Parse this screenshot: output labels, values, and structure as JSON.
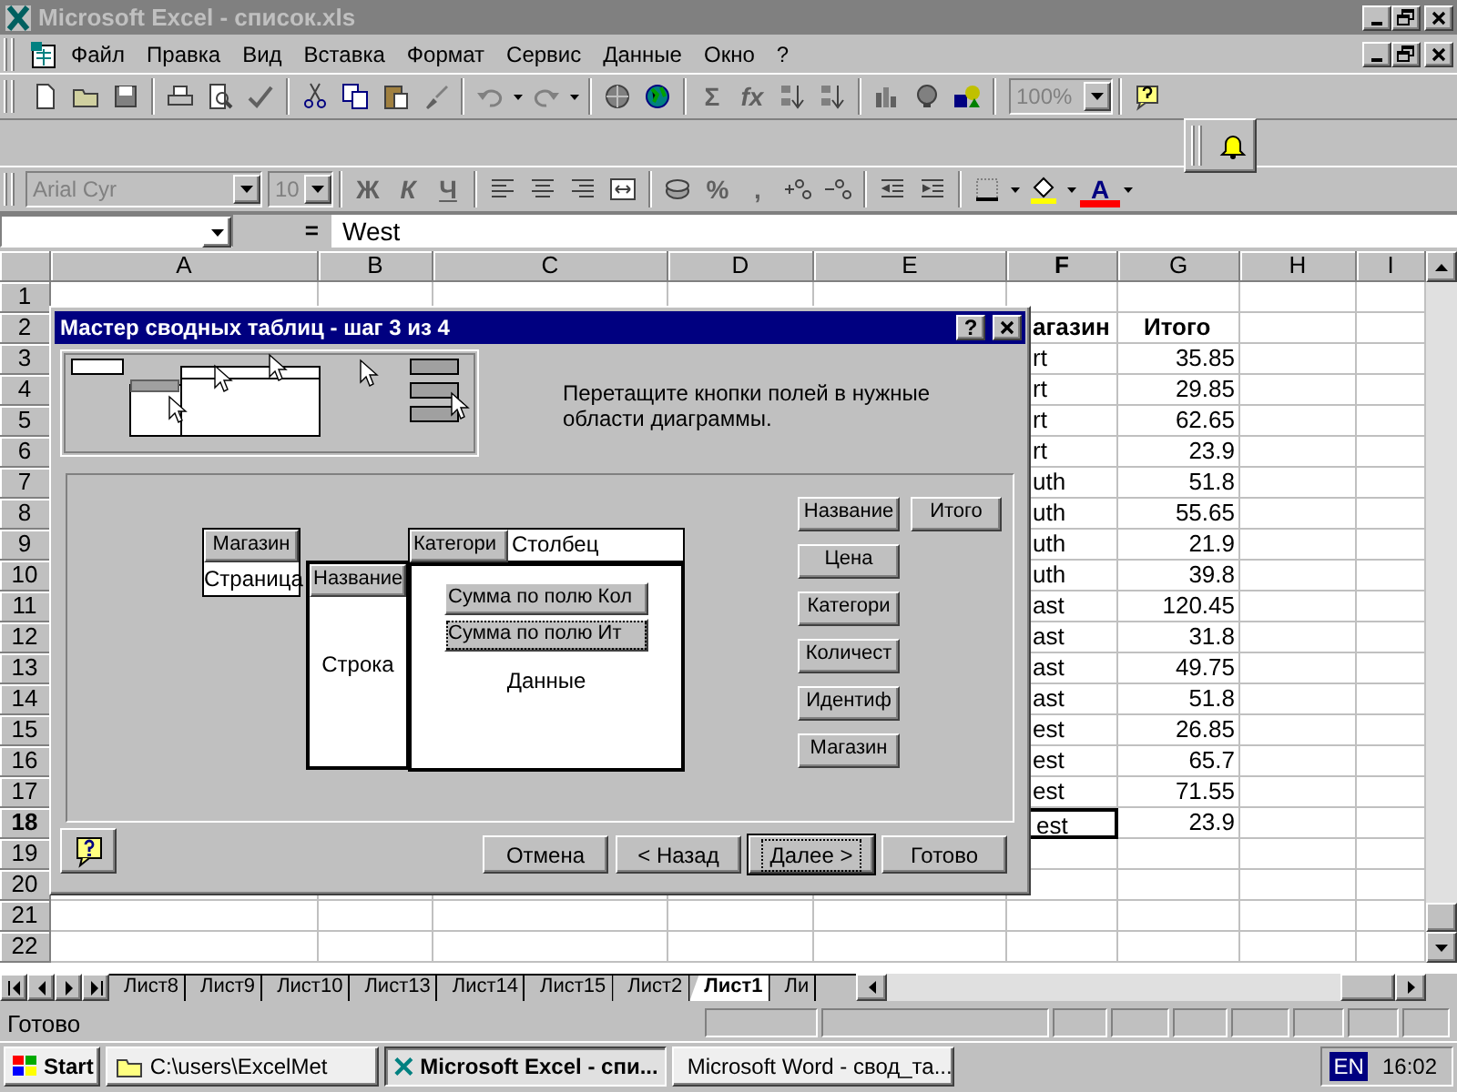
{
  "window": {
    "title": "Microsoft Excel - список.xls"
  },
  "menu": [
    {
      "label": "Файл"
    },
    {
      "label": "Правка"
    },
    {
      "label": "Вид"
    },
    {
      "label": "Вставка"
    },
    {
      "label": "Формат"
    },
    {
      "label": "Сервис"
    },
    {
      "label": "Данные"
    },
    {
      "label": "Окно"
    },
    {
      "label": "?"
    }
  ],
  "standard_toolbar": {
    "autosum": "Σ",
    "function": "fx",
    "zoom": "100%"
  },
  "formatting_toolbar": {
    "font": "Arial Cyr",
    "size": "10",
    "styles": [
      "Ж",
      "К",
      "Ч"
    ],
    "number_formats": [
      "%",
      ","
    ],
    "font_color": "A"
  },
  "formula_bar": {
    "equals": "=",
    "value": "West"
  },
  "sheet": {
    "columns": [
      {
        "label": "A",
        "selected": false
      },
      {
        "label": "B",
        "selected": false
      },
      {
        "label": "C",
        "selected": false
      },
      {
        "label": "D",
        "selected": false
      },
      {
        "label": "E",
        "selected": false
      },
      {
        "label": "F",
        "selected": true
      },
      {
        "label": "G",
        "selected": false
      },
      {
        "label": "H",
        "selected": false
      },
      {
        "label": "I",
        "selected": false
      }
    ],
    "rows": [
      {
        "number": "1",
        "selected": false,
        "cells": {}
      },
      {
        "number": "2",
        "selected": false,
        "cells": {
          "F": {
            "text": "агазин",
            "kind": "heading"
          },
          "G": {
            "text": "Итого",
            "kind": "heading"
          }
        }
      },
      {
        "number": "3",
        "selected": false,
        "cells": {
          "F": {
            "text": "rt",
            "kind": "text"
          },
          "G": {
            "text": "35.85",
            "kind": "number"
          }
        }
      },
      {
        "number": "4",
        "selected": false,
        "cells": {
          "F": {
            "text": "rt",
            "kind": "text"
          },
          "G": {
            "text": "29.85",
            "kind": "number"
          }
        }
      },
      {
        "number": "5",
        "selected": false,
        "cells": {
          "F": {
            "text": "rt",
            "kind": "text"
          },
          "G": {
            "text": "62.65",
            "kind": "number"
          }
        }
      },
      {
        "number": "6",
        "selected": false,
        "cells": {
          "F": {
            "text": "rt",
            "kind": "text"
          },
          "G": {
            "text": "23.9",
            "kind": "number"
          }
        }
      },
      {
        "number": "7",
        "selected": false,
        "cells": {
          "F": {
            "text": "uth",
            "kind": "text"
          },
          "G": {
            "text": "51.8",
            "kind": "number"
          }
        }
      },
      {
        "number": "8",
        "selected": false,
        "cells": {
          "F": {
            "text": "uth",
            "kind": "text"
          },
          "G": {
            "text": "55.65",
            "kind": "number"
          }
        }
      },
      {
        "number": "9",
        "selected": false,
        "cells": {
          "F": {
            "text": "uth",
            "kind": "text"
          },
          "G": {
            "text": "21.9",
            "kind": "number"
          }
        }
      },
      {
        "number": "10",
        "selected": false,
        "cells": {
          "F": {
            "text": "uth",
            "kind": "text"
          },
          "G": {
            "text": "39.8",
            "kind": "number"
          }
        }
      },
      {
        "number": "11",
        "selected": false,
        "cells": {
          "F": {
            "text": "ast",
            "kind": "text"
          },
          "G": {
            "text": "120.45",
            "kind": "number"
          }
        }
      },
      {
        "number": "12",
        "selected": false,
        "cells": {
          "F": {
            "text": "ast",
            "kind": "text"
          },
          "G": {
            "text": "31.8",
            "kind": "number"
          }
        }
      },
      {
        "number": "13",
        "selected": false,
        "cells": {
          "F": {
            "text": "ast",
            "kind": "text"
          },
          "G": {
            "text": "49.75",
            "kind": "number"
          }
        }
      },
      {
        "number": "14",
        "selected": false,
        "cells": {
          "F": {
            "text": "ast",
            "kind": "text"
          },
          "G": {
            "text": "51.8",
            "kind": "number"
          }
        }
      },
      {
        "number": "15",
        "selected": false,
        "cells": {
          "F": {
            "text": "est",
            "kind": "text"
          },
          "G": {
            "text": "26.85",
            "kind": "number"
          }
        }
      },
      {
        "number": "16",
        "selected": false,
        "cells": {
          "F": {
            "text": "est",
            "kind": "text"
          },
          "G": {
            "text": "65.7",
            "kind": "number"
          }
        }
      },
      {
        "number": "17",
        "selected": false,
        "cells": {
          "F": {
            "text": "est",
            "kind": "text"
          },
          "G": {
            "text": "71.55",
            "kind": "number"
          }
        }
      },
      {
        "number": "18",
        "selected": true,
        "cells": {
          "F": {
            "text": "est",
            "kind": "text"
          },
          "G": {
            "text": "23.9",
            "kind": "number"
          }
        }
      },
      {
        "number": "19",
        "selected": false,
        "cells": {}
      },
      {
        "number": "20",
        "selected": false,
        "cells": {}
      },
      {
        "number": "21",
        "selected": false,
        "cells": {}
      },
      {
        "number": "22",
        "selected": false,
        "cells": {}
      }
    ]
  },
  "dialog": {
    "title": "Мастер сводных таблиц - шаг 3 из 4",
    "title_help": "?",
    "instructions": "Перетащите кнопки полей в нужные области диаграммы.",
    "page_area": {
      "fields": [
        "Магазин"
      ],
      "label": "Страница"
    },
    "row_area": {
      "fields": [
        "Название"
      ],
      "label": "Строка"
    },
    "column_area": {
      "fields": [
        "Категори"
      ],
      "label": "Столбец"
    },
    "data_area": {
      "fields": [
        {
          "label": "Сумма по полю Кол",
          "selected": false
        },
        {
          "label": "Сумма по полю Ит",
          "selected": true
        }
      ],
      "label": "Данные"
    },
    "field_columns": [
      [
        "Название",
        "Цена",
        "Категори",
        "Количест",
        "Идентиф",
        "Магазин"
      ],
      [
        "Итого"
      ]
    ],
    "buttons": [
      {
        "label": "Отмена",
        "default": false
      },
      {
        "label": "< Назад",
        "default": false
      },
      {
        "label": "Далее >",
        "default": true
      },
      {
        "label": "Готово",
        "default": false
      }
    ]
  },
  "sheet_tabs": [
    {
      "label": "Лист8",
      "selected": false
    },
    {
      "label": "Лист9",
      "selected": false
    },
    {
      "label": "Лист10",
      "selected": false
    },
    {
      "label": "Лист13",
      "selected": false
    },
    {
      "label": "Лист14",
      "selected": false
    },
    {
      "label": "Лист15",
      "selected": false
    },
    {
      "label": "Лист2",
      "selected": false
    },
    {
      "label": "Лист1",
      "selected": true
    },
    {
      "label": "Ли",
      "selected": false
    }
  ],
  "status_bar": {
    "text": "Готово"
  },
  "taskbar": {
    "start": "Start",
    "tasks": [
      {
        "label": "C:\\users\\ExcelMet",
        "kind": "folder",
        "selected": false
      },
      {
        "label": "Microsoft Excel - спи...",
        "kind": "excel",
        "selected": true
      },
      {
        "label": "Microsoft Word - свод_та...",
        "kind": "word",
        "selected": false
      }
    ],
    "language": "EN",
    "clock": "16:02"
  }
}
